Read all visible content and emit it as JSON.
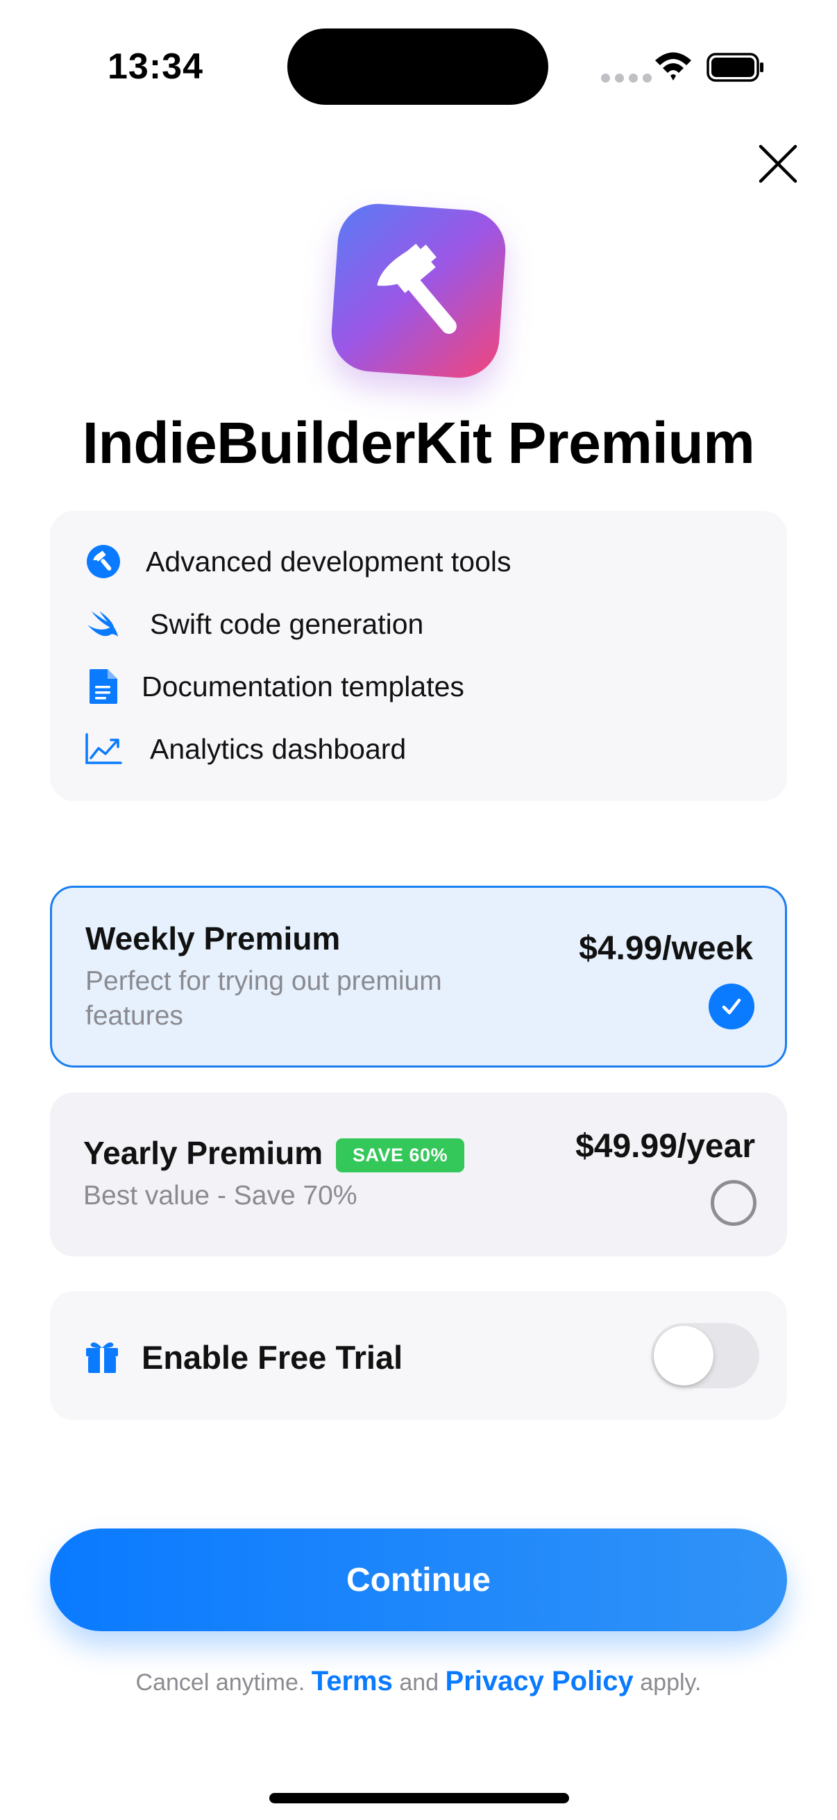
{
  "status_bar": {
    "time": "13:34"
  },
  "header": {
    "title": "IndieBuilderKit Premium"
  },
  "features": [
    {
      "label": "Advanced development tools",
      "icon": "hammer-circle-icon"
    },
    {
      "label": "Swift code generation",
      "icon": "swift-icon"
    },
    {
      "label": "Documentation templates",
      "icon": "document-icon"
    },
    {
      "label": "Analytics dashboard",
      "icon": "chart-icon"
    }
  ],
  "plans": {
    "weekly": {
      "name": "Weekly Premium",
      "description": "Perfect for trying out premium features",
      "price": "$4.99/week",
      "selected": true
    },
    "yearly": {
      "name": "Yearly Premium",
      "badge": "SAVE 60%",
      "description": "Best value - Save 70%",
      "price": "$49.99/year",
      "selected": false
    }
  },
  "trial": {
    "label": "Enable Free Trial",
    "enabled": false
  },
  "cta": {
    "label": "Continue"
  },
  "footer": {
    "prefix": "Cancel anytime.",
    "terms": "Terms",
    "and": "and",
    "privacy": "Privacy Policy",
    "suffix": "apply."
  },
  "colors": {
    "accent": "#0A7AFF",
    "badge": "#34C759",
    "selected_bg": "#E6F1FD",
    "card_bg": "#F7F7FA"
  }
}
